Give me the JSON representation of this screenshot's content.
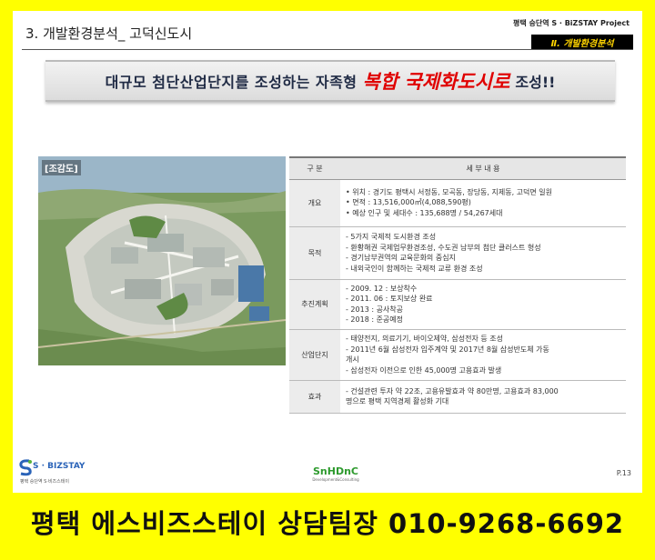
{
  "header": {
    "section_title": "3. 개발환경분석_ 고덕신도시",
    "project_name": "평택 승단역 S · BiZSTAY Project",
    "chapter_tag": "Ⅱ. 개발환경분석"
  },
  "banner": {
    "pre": "대규모 첨단산업단지를 조성하는 자족형",
    "emphasis": "복합 국제화도시로",
    "post": "조성!!"
  },
  "aerial": {
    "label": "[조감도]"
  },
  "table": {
    "headers": [
      "구 분",
      "세 부 내 용"
    ],
    "rows": [
      {
        "category": "개요",
        "lines": [
          "• 위치 : 경기도 평택시 서정동, 모곡동, 장당동, 지제동, 고덕면 일원",
          "• 면적 : 13,516,000㎡(4,088,590평)",
          "• 예상 인구 및 세대수 : 135,688명 / 54,267세대"
        ]
      },
      {
        "category": "목적",
        "lines": [
          "- 5가지 국제적 도시환경 조성",
          "- 환황해권 국제업무환경조성, 수도권 남부의 첨단 클러스트 형성",
          "- 경기남부권역의 교육문화의 중심지",
          "- 내외국인이 함께하는 국제적 교류 환경 조성"
        ]
      },
      {
        "category": "추진계획",
        "lines": [
          "- 2009. 12 : 보상착수",
          "- 2011. 06 : 토지보상 완료",
          "- 2013 : 공사착공",
          "- 2018 : 준공예정"
        ]
      },
      {
        "category": "산업단지",
        "lines": [
          "- 태양전지, 의료기기, 바이오제약, 삼성전자 등 조성",
          "- 2011년 6월 삼성전자 입주계약 및 2017년 8월 삼성반도체 가동",
          "   개시",
          "- 삼성전자 이전으로 인한 45,000명 고용효과 발생"
        ]
      },
      {
        "category": "효과",
        "lines": [
          "- 건설관련 투자 약 22조, 고용유발효과 약 80만명, 고용효과 83,000",
          "   명으로 평택 지역경제 활성화 기대"
        ]
      }
    ]
  },
  "footer": {
    "logo_text": "S · BIZSTAY",
    "logo_sub": "평택 승단역 S·비즈스테이",
    "center_logo": "SnHDnC",
    "center_sub": "Development&Consulting",
    "page_number": "P.13"
  },
  "contact": {
    "text": "평택 에스비즈스테이 상담팀장 010-9268-6692"
  },
  "colors": {
    "background": "#ffff00",
    "emphasis": "#e00000",
    "tag_bg": "#000000",
    "tag_text": "#ffd400"
  }
}
